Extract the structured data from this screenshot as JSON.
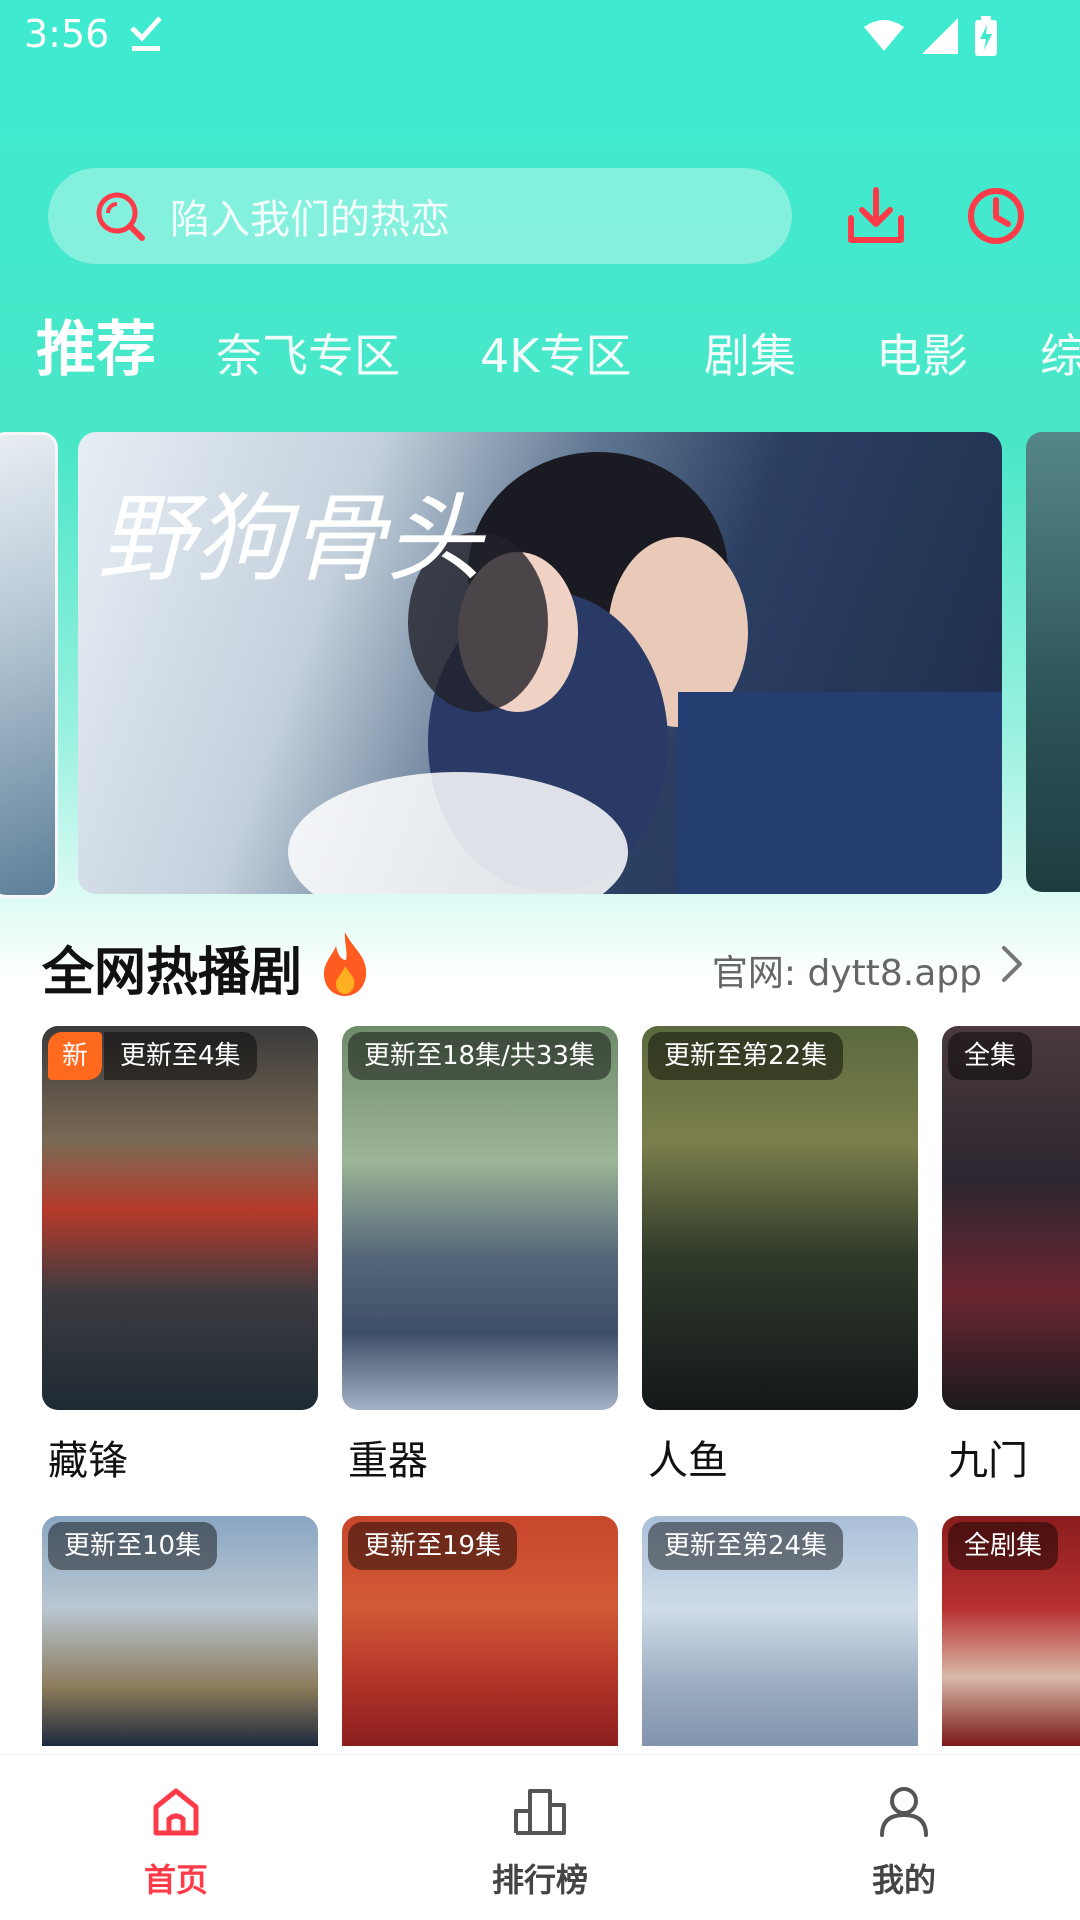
{
  "status_bar": {
    "time": "3:56"
  },
  "search": {
    "placeholder": "陷入我们的热恋"
  },
  "tabs": [
    {
      "label": "推荐",
      "active": true
    },
    {
      "label": "奈飞专区"
    },
    {
      "label": "4K专区"
    },
    {
      "label": "剧集"
    },
    {
      "label": "电影"
    },
    {
      "label": "综"
    }
  ],
  "banner": {
    "title_art": "野狗骨头"
  },
  "section": {
    "title": "全网热播剧",
    "link": "官网: dytt8.app"
  },
  "cards_row1": [
    {
      "title": "藏锋",
      "badge": "更新至4集",
      "new": "新"
    },
    {
      "title": "重器",
      "badge": "更新至18集/共33集"
    },
    {
      "title": "人鱼",
      "badge": "更新至第22集"
    },
    {
      "title": "九门",
      "badge": "全集"
    }
  ],
  "cards_row2": [
    {
      "badge": "更新至10集"
    },
    {
      "badge": "更新至19集"
    },
    {
      "badge": "更新至第24集"
    },
    {
      "badge": "全剧集"
    }
  ],
  "bottom_nav": [
    {
      "label": "首页",
      "active": true
    },
    {
      "label": "排行榜"
    },
    {
      "label": "我的"
    }
  ],
  "colors": {
    "accent_red": "#FF3B4A",
    "header_teal": "#3EEBD0",
    "new_badge": "#FF6A1F"
  }
}
